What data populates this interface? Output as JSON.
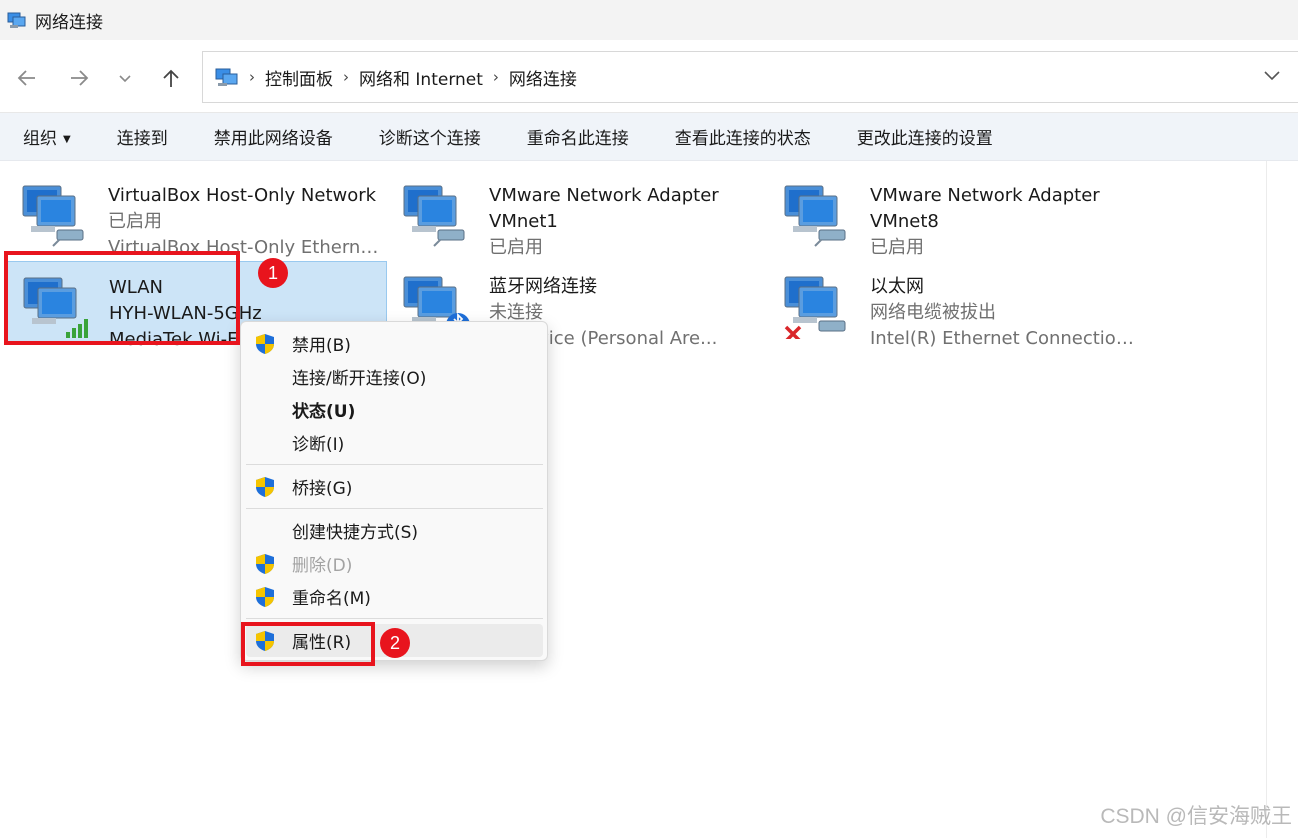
{
  "window": {
    "title": "网络连接"
  },
  "nav": {
    "back_icon": "arrow-left-icon",
    "forward_icon": "arrow-right-icon",
    "recent_icon": "chevron-down-icon",
    "up_icon": "arrow-up-icon",
    "breadcrumb": [
      "控制面板",
      "网络和 Internet",
      "网络连接"
    ],
    "separator": "›"
  },
  "toolbar": {
    "organize": "组织",
    "items": [
      "连接到",
      "禁用此网络设备",
      "诊断这个连接",
      "重命名此连接",
      "查看此连接的状态",
      "更改此连接的设置"
    ]
  },
  "connections": [
    {
      "name": "VirtualBox Host-Only Network",
      "status": "已启用",
      "device": "VirtualBox Host-Only Ethernet ..."
    },
    {
      "name": "VMware Network Adapter",
      "status": "VMnet1",
      "device": "已启用"
    },
    {
      "name": "VMware Network Adapter",
      "status": "VMnet8",
      "device": "已启用"
    },
    {
      "name": "WLAN",
      "status": "HYH-WLAN-5GHz",
      "device": "MediaTek Wi-F"
    },
    {
      "name": "蓝牙网络连接",
      "status": "未连接",
      "device": "th Device (Personal Are..."
    },
    {
      "name": "以太网",
      "status": "网络电缆被拔出",
      "device": "Intel(R) Ethernet Connection (1..."
    }
  ],
  "context_menu": {
    "items": [
      {
        "label": "禁用(B)",
        "shield": true
      },
      {
        "label": "连接/断开连接(O)",
        "shield": false
      },
      {
        "label": "状态(U)",
        "shield": false,
        "bold": true
      },
      {
        "label": "诊断(I)",
        "shield": false
      },
      {
        "label": "桥接(G)",
        "shield": true
      },
      {
        "label": "创建快捷方式(S)",
        "shield": false
      },
      {
        "label": "删除(D)",
        "shield": true,
        "disabled": true
      },
      {
        "label": "重命名(M)",
        "shield": true
      },
      {
        "label": "属性(R)",
        "shield": true
      }
    ]
  },
  "annotations": {
    "badge1": "1",
    "badge2": "2"
  },
  "watermark": "CSDN @信安海贼王",
  "colors": {
    "selected_bg": "#cce4f7",
    "annotation_red": "#e8141d",
    "cmdbar_bg": "#f0f4f9"
  }
}
